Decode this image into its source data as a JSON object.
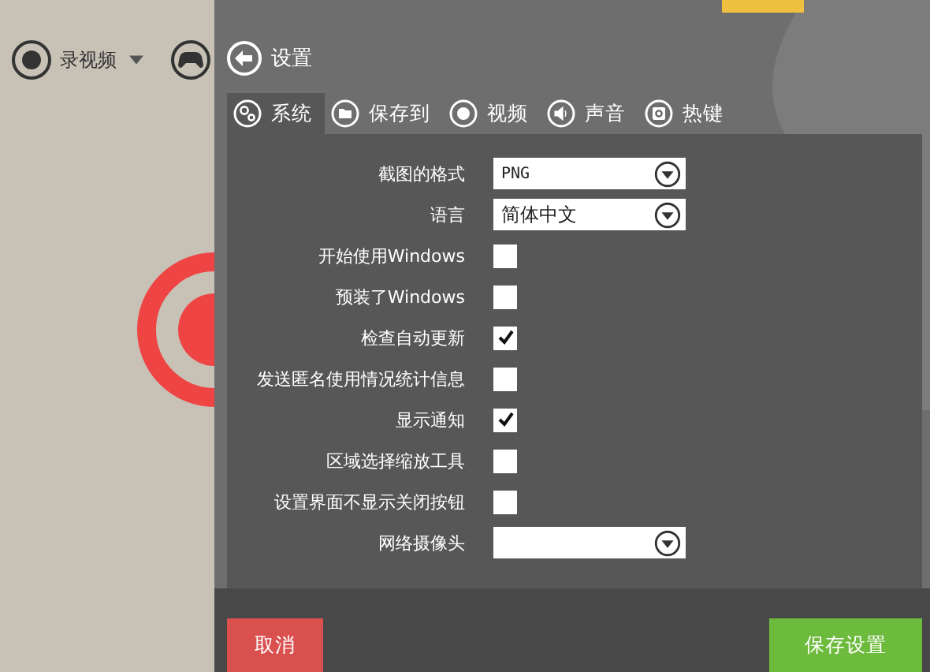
{
  "top_bar": {
    "vip_button": true
  },
  "recorder": {
    "mode_label": "录视频"
  },
  "header": {
    "title": "设置"
  },
  "tabs": [
    {
      "label": "系统",
      "kind": "gears",
      "selected": true
    },
    {
      "label": "保存到",
      "kind": "folder",
      "selected": false
    },
    {
      "label": "视频",
      "kind": "record",
      "selected": false
    },
    {
      "label": "声音",
      "kind": "speaker",
      "selected": false
    },
    {
      "label": "热键",
      "kind": "key",
      "selected": false
    }
  ],
  "settings": [
    {
      "label": "截图的格式",
      "kind": "dropdown",
      "value": "PNG"
    },
    {
      "label": "语言",
      "kind": "dropdown",
      "value": "简体中文"
    },
    {
      "label": "开始使用Windows",
      "kind": "checkbox",
      "checked": false
    },
    {
      "label": "预装了Windows",
      "kind": "checkbox",
      "checked": false
    },
    {
      "label": "检查自动更新",
      "kind": "checkbox",
      "checked": true
    },
    {
      "label": "发送匿名使用情况统计信息",
      "kind": "checkbox",
      "checked": false
    },
    {
      "label": "显示通知",
      "kind": "checkbox",
      "checked": true
    },
    {
      "label": "区域选择缩放工具",
      "kind": "checkbox",
      "checked": false
    },
    {
      "label": "设置界面不显示关闭按钮",
      "kind": "checkbox",
      "checked": false
    },
    {
      "label": "网络摄像头",
      "kind": "dropdown"
    }
  ],
  "buttons": {
    "cancel": "取消",
    "save": "保存设置"
  }
}
